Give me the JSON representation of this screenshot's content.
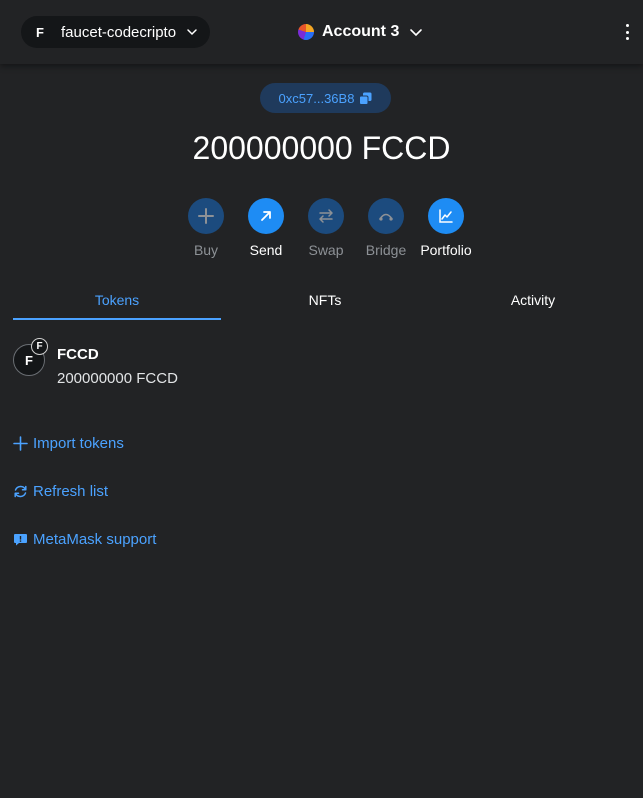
{
  "header": {
    "network_avatar": "F",
    "network_name": "faucet-codecripto",
    "account_name": "Account 3"
  },
  "address": {
    "short": "0xc57...36B8"
  },
  "balance": {
    "text": "200000000 FCCD"
  },
  "actions": [
    {
      "label": "Buy",
      "icon": "plus-icon",
      "enabled": false
    },
    {
      "label": "Send",
      "icon": "arrow-up-right-icon",
      "enabled": true
    },
    {
      "label": "Swap",
      "icon": "swap-arrows-icon",
      "enabled": false
    },
    {
      "label": "Bridge",
      "icon": "bridge-icon",
      "enabled": false
    },
    {
      "label": "Portfolio",
      "icon": "chart-line-icon",
      "enabled": true
    }
  ],
  "tabs": [
    {
      "label": "Tokens",
      "active": true
    },
    {
      "label": "NFTs",
      "active": false
    },
    {
      "label": "Activity",
      "active": false
    }
  ],
  "tokens": [
    {
      "avatar": "F",
      "badge": "F",
      "symbol": "FCCD",
      "amount": "200000000 FCCD"
    }
  ],
  "links": {
    "import_tokens": "Import tokens",
    "refresh_list": "Refresh list",
    "support": "MetaMask support"
  },
  "colors": {
    "background": "#222325",
    "accent": "#4ba2ff",
    "primary_button": "#1e8cf4",
    "disabled_button": "#1c4b7e",
    "address_pill": "#1f3a5c",
    "muted_text": "#8d9196"
  }
}
